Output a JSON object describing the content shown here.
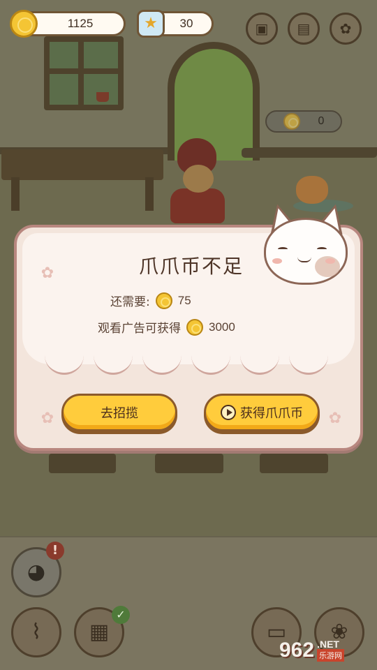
{
  "hud": {
    "coins": "1125",
    "stars": "30",
    "top_buttons": [
      "backpack-icon",
      "recipe-book-icon",
      "settings-gear-icon"
    ]
  },
  "scene": {
    "tip_value": "0"
  },
  "dialog": {
    "title": "爪爪币不足",
    "need_label": "还需要:",
    "need_value": "75",
    "ad_label": "观看广告可获得",
    "ad_value": "3000",
    "btn_recruit": "去招揽",
    "btn_get": "获得爪爪币"
  },
  "bottom_bar": {
    "items": [
      "cat-chat-icon",
      "broom-icon",
      "calendar-book-icon",
      "tv-icon",
      "decor-icon"
    ]
  },
  "watermark": {
    "number": "962",
    "suffix": ".NET",
    "site": "乐游网"
  },
  "colors": {
    "coin": "#f4c534",
    "button": "#ffcc3c",
    "dialog_bg": "#f3e5dc",
    "dialog_border": "#b8877f",
    "dim_scene": "#6d6a4f"
  }
}
